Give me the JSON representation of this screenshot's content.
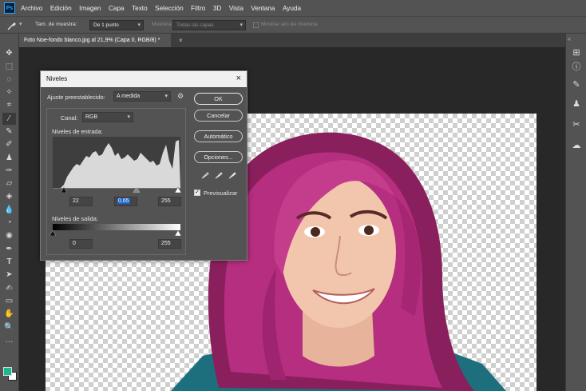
{
  "menubar": {
    "app_logo": "Ps",
    "items": [
      "Archivo",
      "Edición",
      "Imagen",
      "Capa",
      "Texto",
      "Selección",
      "Filtro",
      "3D",
      "Vista",
      "Ventana",
      "Ayuda"
    ]
  },
  "options_bar": {
    "tool_icon": "eyedropper-icon",
    "sample_size_label": "Tam. de muestra:",
    "sample_size_value": "De 1 punto",
    "sample_label": "Muestra:",
    "sample_value": "Todas las capas",
    "show_ring_label": "Mostrar aro de muestra"
  },
  "document_tab": {
    "title": "Foto Noe-fondo blanco.jpg al 21,9% (Capa 0, RGB/8) *",
    "close": "×"
  },
  "dialog": {
    "title": "Niveles",
    "close": "×",
    "preset_label": "Ajuste preestablecido:",
    "preset_value": "A medida",
    "channel_label": "Canal:",
    "channel_value": "RGB",
    "input_levels_label": "Niveles de entrada:",
    "input_black": "22",
    "input_gamma": "0,65",
    "input_white": "255",
    "output_levels_label": "Niveles de salida:",
    "output_black": "0",
    "output_white": "255",
    "buttons": {
      "ok": "OK",
      "cancel": "Cancelar",
      "auto": "Automático",
      "options": "Opciones..."
    },
    "preview_label": "Previsualizar",
    "preview_checked": true,
    "eyedroppers": [
      "black-eyedropper-icon",
      "gray-eyedropper-icon",
      "white-eyedropper-icon"
    ]
  },
  "colors": {
    "foreground": "#1ab88a",
    "background": "#ffffff",
    "ui_dark": "#535353",
    "accent_ps": "#31a8ff"
  }
}
